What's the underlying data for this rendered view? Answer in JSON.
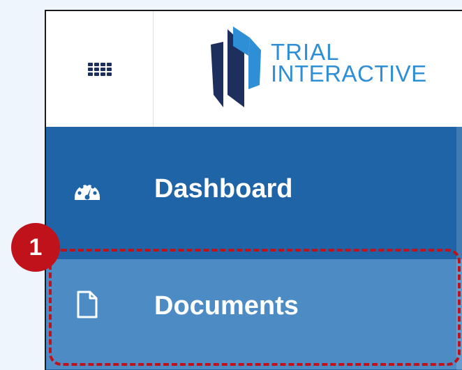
{
  "header": {
    "menu_icon": "grid-menu-icon",
    "logo": {
      "line1": "TRIAL",
      "line2": "INTERACTIVE"
    }
  },
  "sidebar": {
    "items": [
      {
        "label": "Dashboard",
        "icon": "dashboard-gauge-icon",
        "state": "default"
      },
      {
        "label": "Documents",
        "icon": "document-icon",
        "state": "selected"
      }
    ]
  },
  "annotation": {
    "step_number": "1",
    "color": "#c0121b"
  },
  "colors": {
    "sidebar_bg": "#1f64a6",
    "selected_item_bg": "#4d8bc4",
    "logo_blue": "#2f8fd6",
    "logo_navy": "#1d2f5c",
    "page_bg": "#eef5fc"
  }
}
